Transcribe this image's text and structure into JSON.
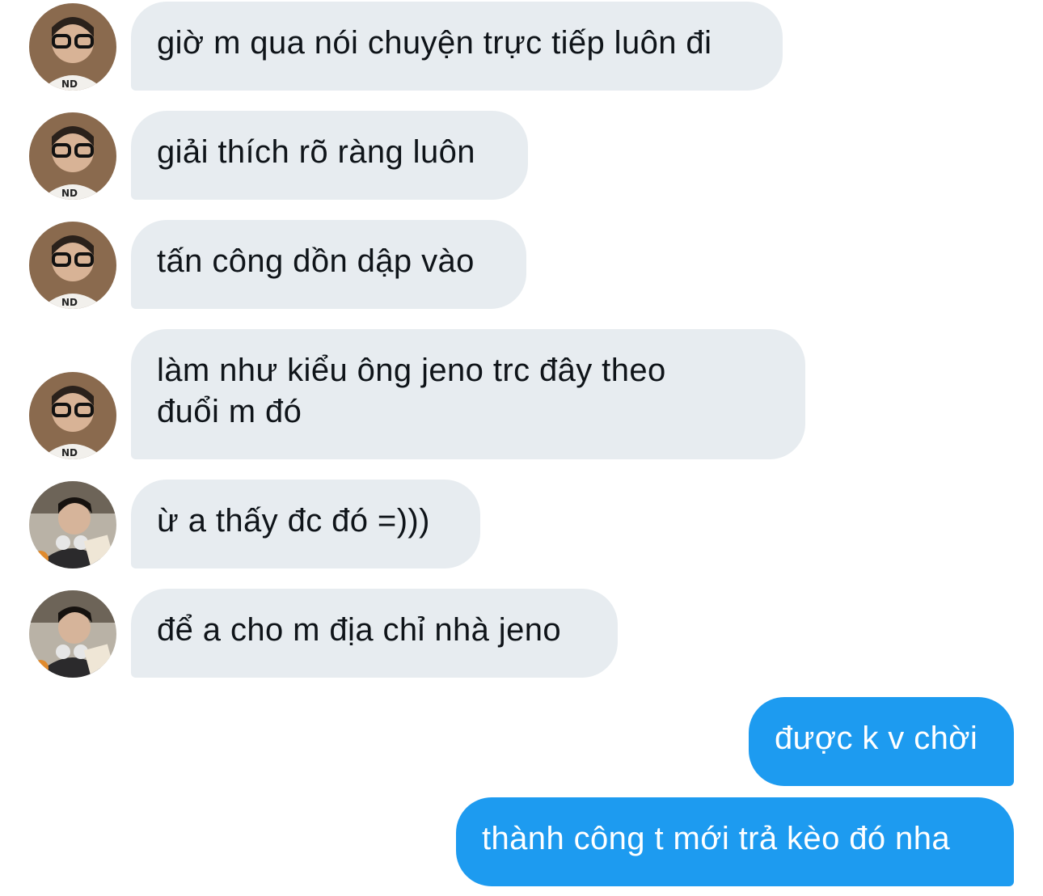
{
  "conversation": {
    "messages": [
      {
        "sender": "other",
        "avatar": "avatar-glasses",
        "text": "giờ m qua nói chuyện trực tiếp luôn đi"
      },
      {
        "sender": "other",
        "avatar": "avatar-glasses",
        "text": "giải thích rõ ràng luôn"
      },
      {
        "sender": "other",
        "avatar": "avatar-glasses",
        "text": "tấn công dồn dập vào"
      },
      {
        "sender": "other",
        "avatar": "avatar-glasses",
        "text": "làm như kiểu ông jeno trc đây theo\nđuổi m đó"
      },
      {
        "sender": "other",
        "avatar": "avatar-dark-hoodie",
        "text": "ừ a thấy đc đó =)))"
      },
      {
        "sender": "other",
        "avatar": "avatar-dark-hoodie",
        "text": "để a cho m địa chỉ nhà jeno"
      },
      {
        "sender": "me",
        "text": "được k v chời"
      },
      {
        "sender": "me",
        "text": "thành công t mới trả kèo đó nha"
      }
    ]
  },
  "colors": {
    "incoming_bubble": "#e7ecf0",
    "outgoing_bubble": "#1d9bf0",
    "incoming_text": "#0f1419",
    "outgoing_text": "#ffffff"
  }
}
